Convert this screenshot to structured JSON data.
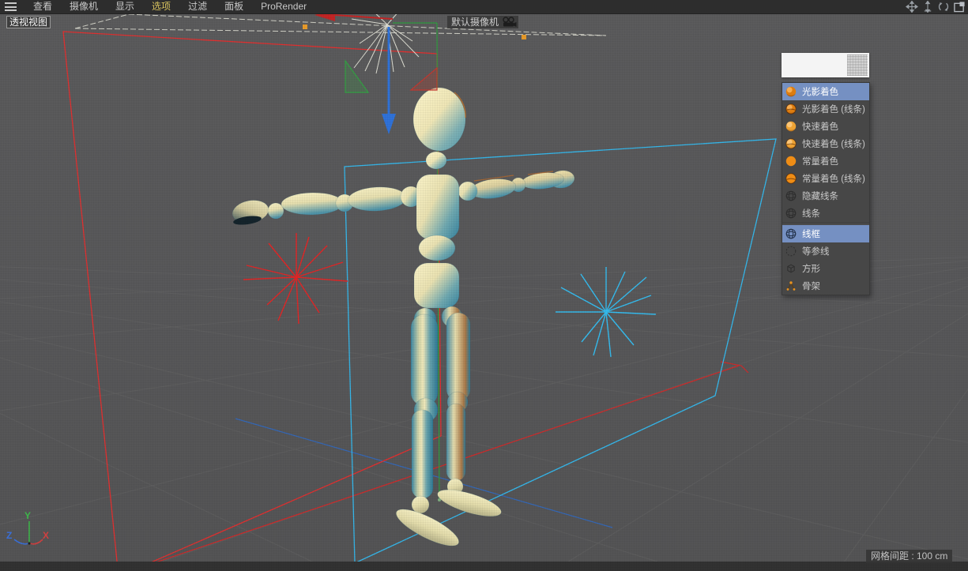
{
  "menu_bar": {
    "items": [
      {
        "label": "查看",
        "highlighted": false
      },
      {
        "label": "摄像机",
        "highlighted": false
      },
      {
        "label": "显示",
        "highlighted": false
      },
      {
        "label": "选项",
        "highlighted": true
      },
      {
        "label": "过滤",
        "highlighted": false
      },
      {
        "label": "面板",
        "highlighted": false
      },
      {
        "label": "ProRender",
        "highlighted": false
      }
    ],
    "highlight_color": "#d8c35e",
    "view_icons": [
      {
        "name": "pan-view-icon"
      },
      {
        "name": "dolly-view-icon"
      },
      {
        "name": "rotate-view-icon"
      },
      {
        "name": "toggle-layout-icon"
      }
    ]
  },
  "viewport": {
    "view_label": "透视视图",
    "camera_label": "默认摄像机",
    "grid_label": "网格间距 : 100 cm",
    "axis_labels": {
      "x": "X",
      "y": "Y",
      "z": "Z"
    }
  },
  "display_menu": {
    "selected_color": "#7590c2",
    "items": [
      {
        "label": "光影着色",
        "icon": "sphere-shaded",
        "selected": true
      },
      {
        "label": "光影着色 (线条)",
        "icon": "sphere-shaded-lines",
        "selected": false
      },
      {
        "label": "快速着色",
        "icon": "sphere-quick",
        "selected": false
      },
      {
        "label": "快速着色 (线条)",
        "icon": "sphere-quick-lines",
        "selected": false
      },
      {
        "label": "常量着色",
        "icon": "sphere-flat",
        "selected": false
      },
      {
        "label": "常量着色 (线条)",
        "icon": "sphere-flat-lines",
        "selected": false
      },
      {
        "label": "隐藏线条",
        "icon": "wire-hidden",
        "selected": false
      },
      {
        "label": "线条",
        "icon": "wire-lines",
        "selected": false
      },
      {
        "label": "线框",
        "icon": "wireframe",
        "selected": true,
        "group_start": true
      },
      {
        "label": "等参线",
        "icon": "isoparms",
        "selected": false
      },
      {
        "label": "方形",
        "icon": "box",
        "selected": false
      },
      {
        "label": "骨架",
        "icon": "skeleton",
        "selected": false
      }
    ]
  },
  "scene_colors": {
    "red_light": "#e02c2c",
    "blue_light": "#35b6e9",
    "axis_x": "#d04040",
    "axis_y": "#3db54a",
    "axis_z": "#3a6fd8",
    "selection_white": "#ddddd2",
    "handle_orange": "#e89b2a"
  }
}
